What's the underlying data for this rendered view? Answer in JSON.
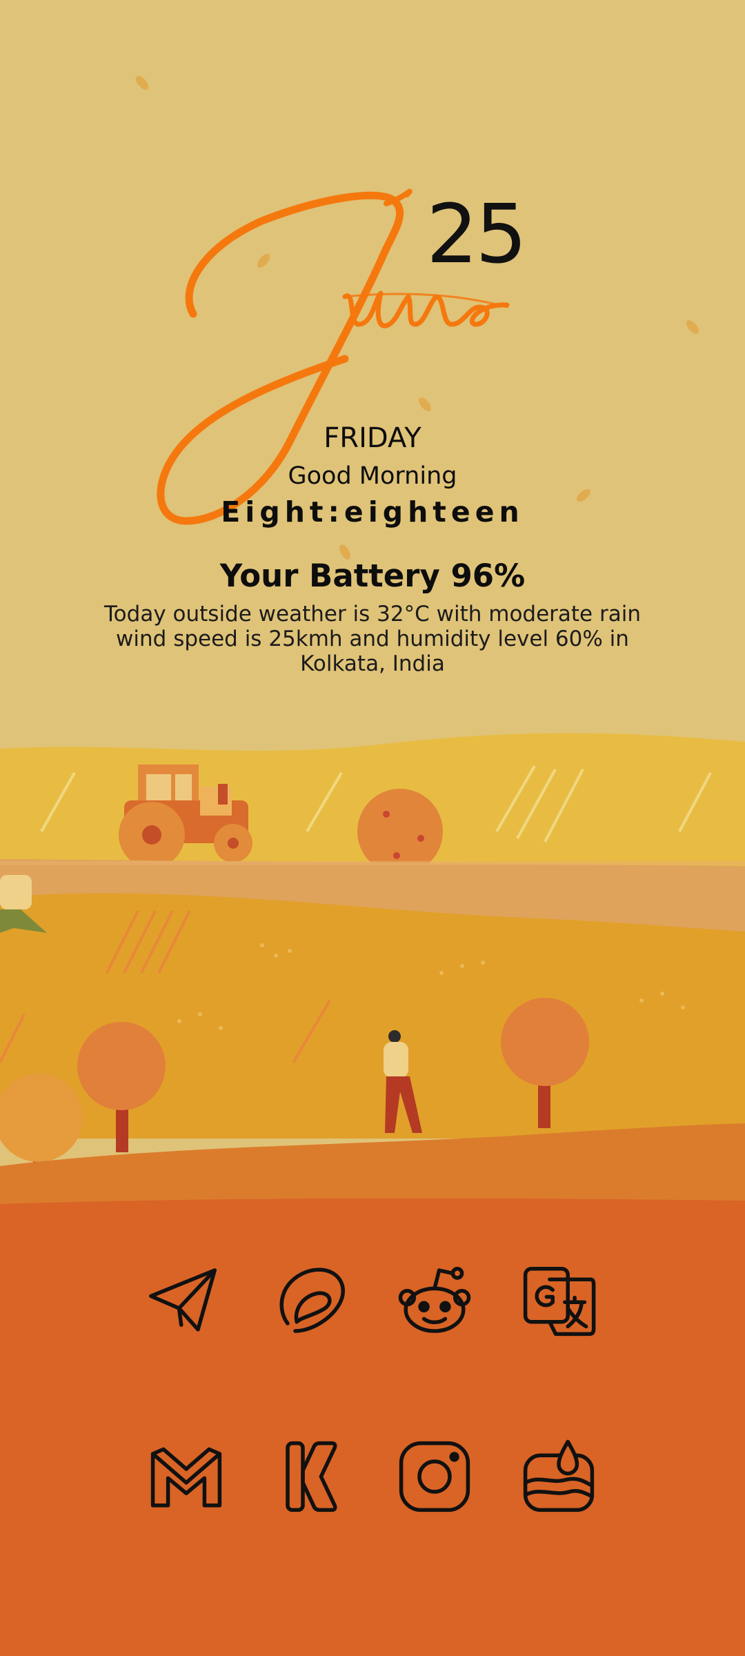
{
  "clock": {
    "day": "25",
    "month": "June",
    "weekday": "FRIDAY",
    "greeting": "Good Morning",
    "time_words": "Eight:eighteen"
  },
  "battery": {
    "text": "Your Battery 96%"
  },
  "weather": {
    "text": "Today outside weather is 32°C with moderate rain wind speed is 25kmh and humidity level 60% in Kolkata, India"
  },
  "apps": [
    {
      "name": "Telegram",
      "icon": "telegram-icon"
    },
    {
      "name": "Pocket Casts",
      "icon": "pocket-casts-icon"
    },
    {
      "name": "Reddit",
      "icon": "reddit-icon"
    },
    {
      "name": "Google Translate",
      "icon": "translate-icon"
    },
    {
      "name": "Gmail",
      "icon": "gmail-icon"
    },
    {
      "name": "KWGT",
      "icon": "kwgt-icon"
    },
    {
      "name": "Instagram",
      "icon": "instagram-icon"
    },
    {
      "name": "Weather",
      "icon": "weather-app-icon"
    }
  ],
  "colors": {
    "sky": "#DFC378",
    "accent_orange": "#F5780E",
    "ground": "#D96426",
    "icon_stroke": "#111111"
  }
}
